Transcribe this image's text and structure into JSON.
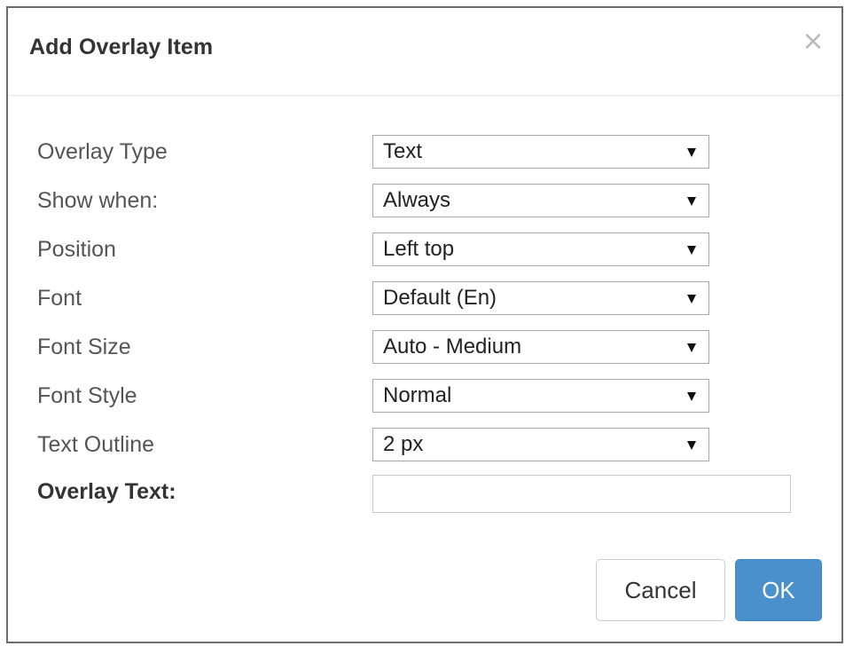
{
  "dialog": {
    "title": "Add Overlay Item",
    "close_glyph": "×"
  },
  "form": {
    "rows": [
      {
        "label": "Overlay Type",
        "value": "Text"
      },
      {
        "label": "Show when:",
        "value": "Always"
      },
      {
        "label": "Position",
        "value": "Left top"
      },
      {
        "label": "Font",
        "value": "Default (En)"
      },
      {
        "label": "Font Size",
        "value": "Auto - Medium"
      },
      {
        "label": "Font Style",
        "value": "Normal"
      },
      {
        "label": "Text Outline",
        "value": "2 px"
      }
    ],
    "overlay_text": {
      "label": "Overlay Text:",
      "value": "",
      "placeholder": ""
    }
  },
  "buttons": {
    "cancel": "Cancel",
    "ok": "OK"
  },
  "colors": {
    "primary": "#4a90cd",
    "border": "#6b6b6b"
  }
}
